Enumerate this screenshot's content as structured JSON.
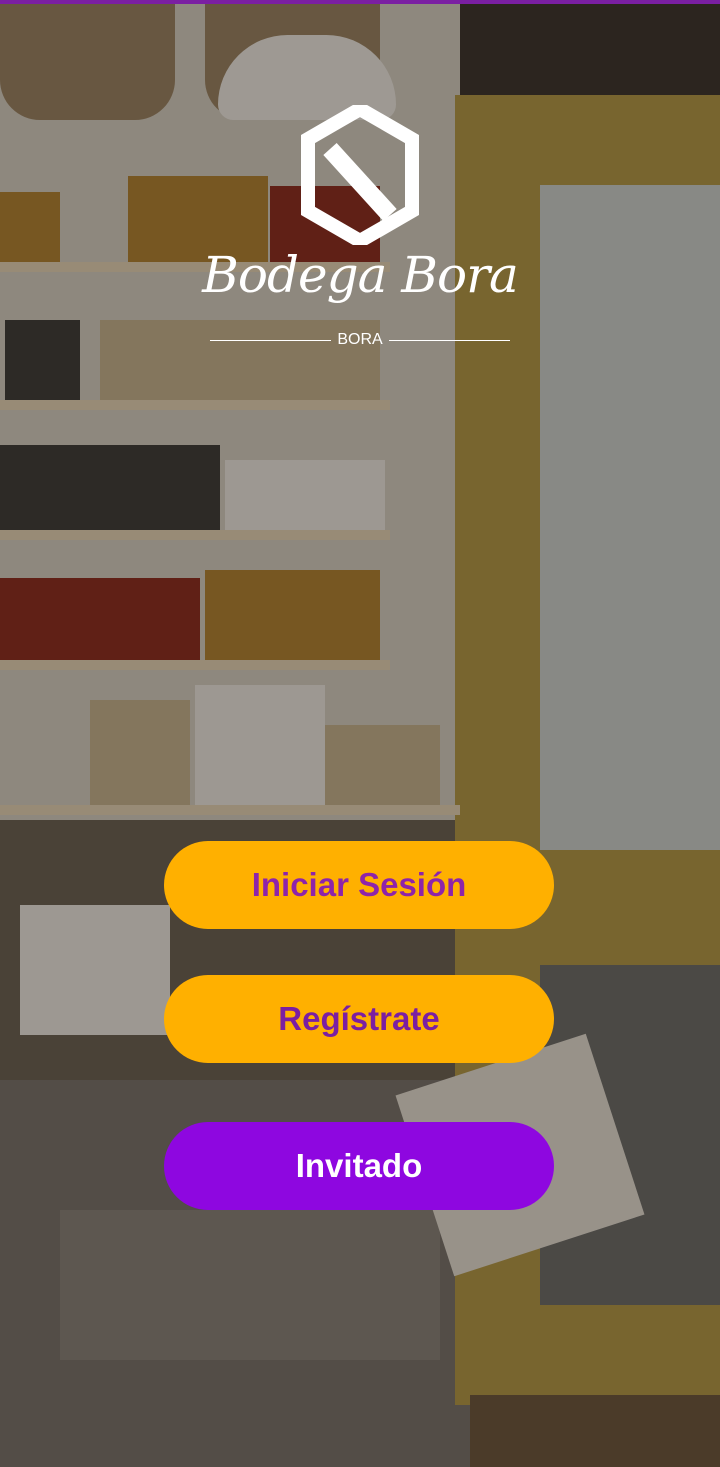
{
  "brand": {
    "wordmark": "Bodega Bora",
    "subtitle": "BORA",
    "logo_icon": "hexagon-logo-icon"
  },
  "actions": {
    "login_label": "Iniciar Sesión",
    "register_label": "Regístrate",
    "guest_label": "Invitado"
  },
  "colors": {
    "accent_bar": "#7b1fa2",
    "primary_button": "#ffb000",
    "primary_button_text": "#8e24aa",
    "guest_button": "#8e07e0",
    "guest_button_text": "#ffffff"
  }
}
